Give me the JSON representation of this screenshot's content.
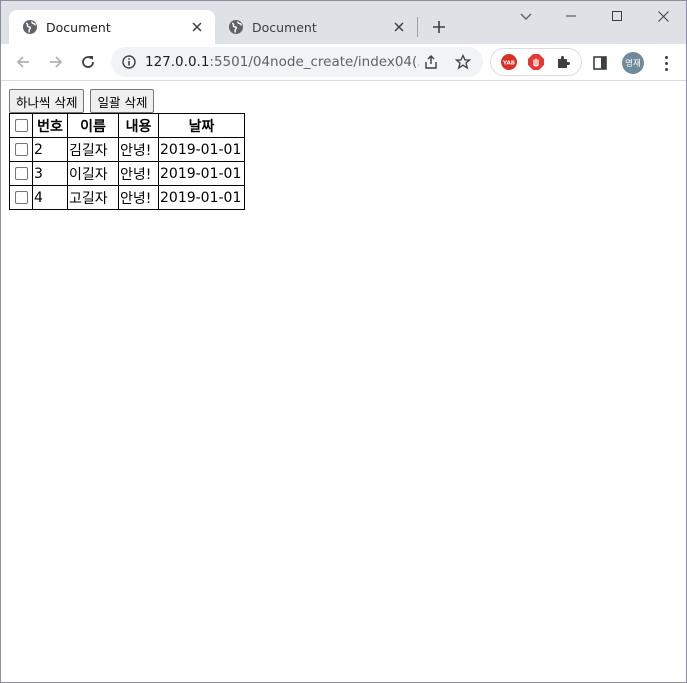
{
  "browser": {
    "tabs": [
      {
        "title": "Document",
        "active": true
      },
      {
        "title": "Document",
        "active": false
      }
    ],
    "url_host": "127.0.0.1",
    "url_rest": ":5501/04node_create/index04(...",
    "profile_initials": "영재",
    "extensions": [
      "yab-icon",
      "adblock-icon",
      "puzzle-icon"
    ],
    "colors": {
      "tabstrip": "#dee1e6",
      "omnibox": "#f1f3f4",
      "avatar": "#6f8a99"
    }
  },
  "page": {
    "buttons": {
      "delete_one": "하나씩 삭제",
      "delete_all": "일괄 삭제"
    },
    "table": {
      "headers": [
        "번호",
        "이름",
        "내용",
        "날짜"
      ],
      "rows": [
        {
          "num": "2",
          "name": "김길자",
          "content": "안녕!",
          "date": "2019-01-01"
        },
        {
          "num": "3",
          "name": "이길자",
          "content": "안녕!",
          "date": "2019-01-01"
        },
        {
          "num": "4",
          "name": "고길자",
          "content": "안녕!",
          "date": "2019-01-01"
        }
      ]
    }
  }
}
